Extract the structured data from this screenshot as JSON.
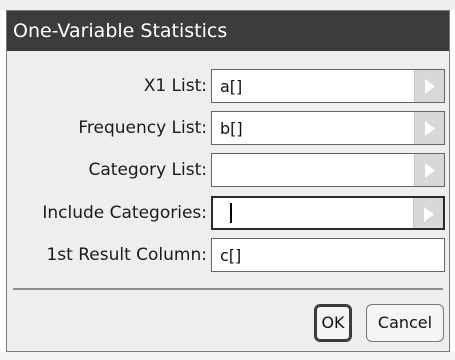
{
  "dialog": {
    "title": "One-Variable Statistics",
    "fields": [
      {
        "label": "X1 List:",
        "value": "a[]"
      },
      {
        "label": "Frequency List:",
        "value": "b[]"
      },
      {
        "label": "Category List:",
        "value": ""
      },
      {
        "label": "Include Categories:",
        "value": ""
      },
      {
        "label": "1st Result Column:",
        "value": "c[]"
      }
    ],
    "buttons": {
      "ok": "OK",
      "cancel": "Cancel"
    }
  },
  "icons": {
    "dropdown_arrow": "triangle-right-icon"
  },
  "colors": {
    "titlebar": "#3b3b3b",
    "dialog_bg": "#eeeeee",
    "arrow_bg": "#d8d8d8"
  }
}
